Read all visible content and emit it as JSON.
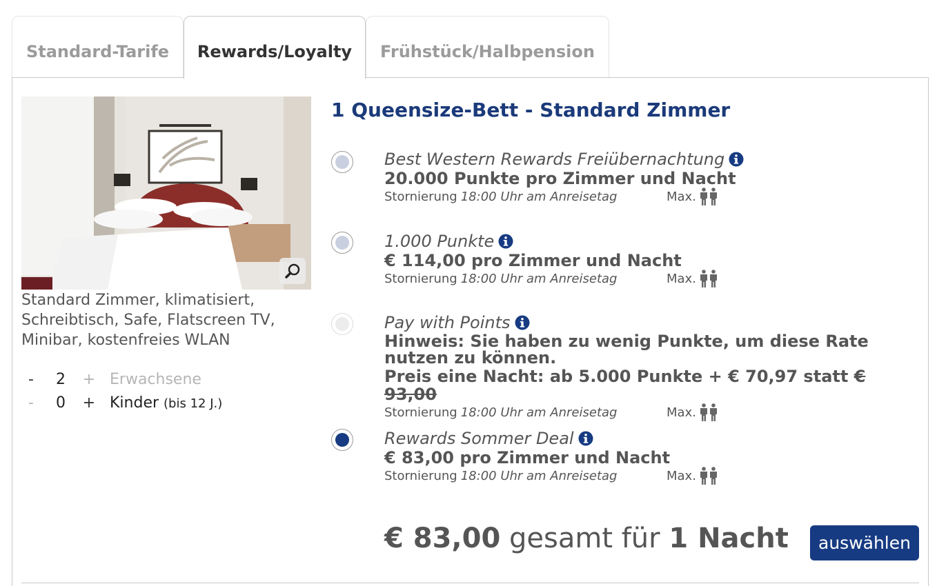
{
  "tabs": [
    {
      "label": "Standard-Tarife",
      "active": false
    },
    {
      "label": "Rewards/Loyalty",
      "active": true
    },
    {
      "label": "Frühstück/Halbpension",
      "active": false
    }
  ],
  "room": {
    "title": "1 Queensize-Bett - Standard Zimmer",
    "description": "Standard Zimmer, klimatisiert, Schreibtisch, Safe, Flatscreen TV, Minibar, kostenfreies WLAN",
    "photo_icon": "zoom-icon"
  },
  "occupancy": {
    "adults": {
      "minus": "-",
      "count": "2",
      "plus": "+",
      "label": "Erwachsene"
    },
    "children": {
      "minus": "-",
      "count": "0",
      "plus": "+",
      "label": "Kinder",
      "note": "(bis 12 J.)"
    }
  },
  "rates": [
    {
      "name": "Best Western Rewards Freiübernachtung",
      "price": "20.000 Punkte pro Zimmer und Nacht",
      "cancel_label": "Stornierung",
      "cancel_time": "18:00 Uhr am Anreisetag",
      "max_label": "Max.",
      "state": "available"
    },
    {
      "name": "1.000 Punkte",
      "price": "€ 114,00 pro Zimmer und Nacht",
      "cancel_label": "Stornierung",
      "cancel_time": "18:00 Uhr am Anreisetag",
      "max_label": "Max.",
      "state": "available"
    },
    {
      "name": "Pay with Points",
      "notice": "Hinweis: Sie haben zu wenig Punkte, um diese Rate nutzen zu können.",
      "price_prefix": "Preis eine Nacht: ab 5.000 Punkte + € 70,97 statt",
      "price_old": "€ 93,00",
      "cancel_label": "Stornierung",
      "cancel_time": "18:00 Uhr am Anreisetag",
      "max_label": "Max.",
      "state": "disabled"
    },
    {
      "name": "Rewards Sommer Deal",
      "price": "€ 83,00 pro Zimmer und Nacht",
      "cancel_label": "Stornierung",
      "cancel_time": "18:00 Uhr am Anreisetag",
      "max_label": "Max.",
      "state": "selected"
    }
  ],
  "summary": {
    "amount": "€ 83,00",
    "middle": "gesamt für",
    "nights": "1 Nacht",
    "button_label": "auswählen"
  },
  "colors": {
    "brand": "#173b82",
    "title": "#1b3a7a",
    "text": "#555555"
  }
}
